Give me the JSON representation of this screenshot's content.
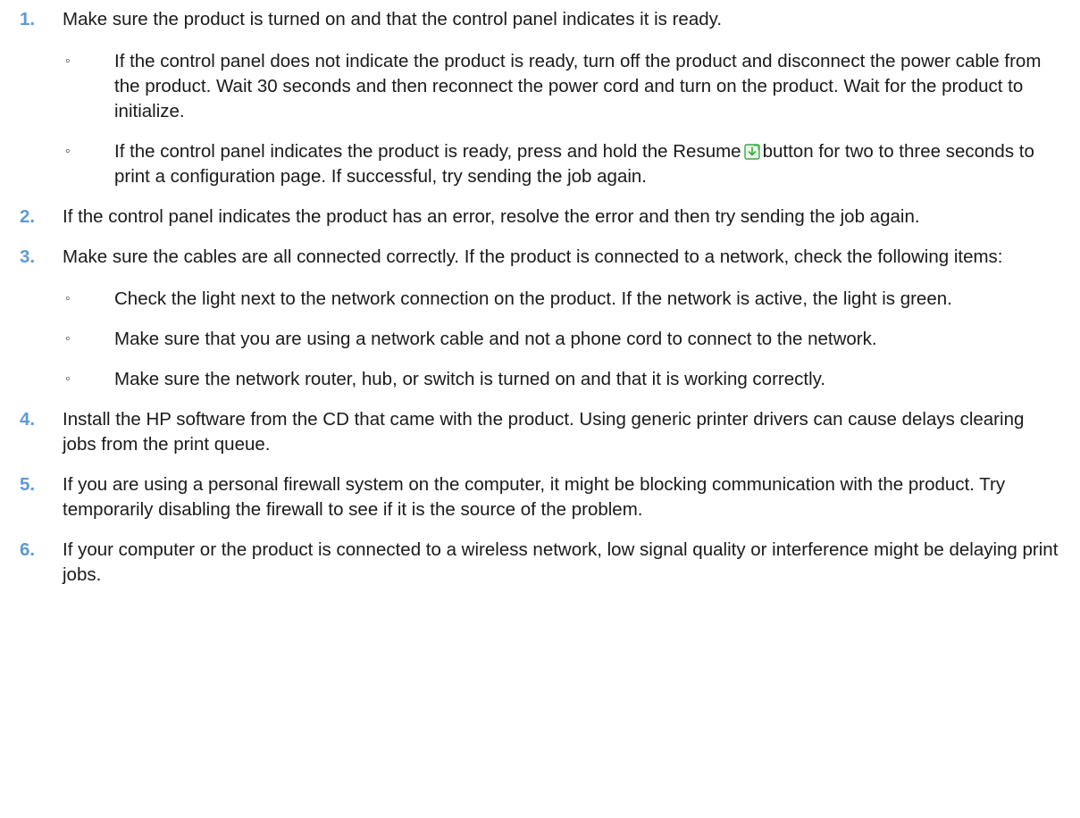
{
  "steps": [
    {
      "number": "1.",
      "text": "Make sure the product is turned on and that the control panel indicates it is ready.",
      "subs": [
        {
          "bullet": "◦",
          "text": "If the control panel does not indicate the product is ready, turn off the product and disconnect the power cable from the product. Wait 30 seconds and then reconnect the power cord and turn on the product. Wait for the product to initialize."
        },
        {
          "bullet": "◦",
          "text_before": "If the control panel indicates the product is ready, press and hold the Resume",
          "icon": "resume-icon",
          "text_after": "button for two to three seconds to print a configuration page. If successful, try sending the job again."
        }
      ]
    },
    {
      "number": "2.",
      "text": "If the control panel indicates the product has an error, resolve the error and then try sending the job again."
    },
    {
      "number": "3.",
      "text": "Make sure the cables are all connected correctly. If the product is connected to a network, check the following items:",
      "subs": [
        {
          "bullet": "◦",
          "text": "Check the light next to the network connection on the product. If the network is active, the light is green."
        },
        {
          "bullet": "◦",
          "text": "Make sure that you are using a network cable and not a phone cord to connect to the network."
        },
        {
          "bullet": "◦",
          "text": "Make sure the network router, hub, or switch is turned on and that it is working correctly."
        }
      ]
    },
    {
      "number": "4.",
      "text": "Install the HP software from the CD that came with the product. Using generic printer drivers can cause delays clearing jobs from the print queue."
    },
    {
      "number": "5.",
      "text": "If you are using a personal firewall system on the computer, it might be blocking communication with the product. Try temporarily disabling the firewall to see if it is the source of the problem."
    },
    {
      "number": "6.",
      "text": "If your computer or the product is connected to a wireless network, low signal quality or interference might be delaying print jobs."
    }
  ],
  "colors": {
    "step_number": "#5b9bd5",
    "resume_icon": "#3aa845"
  }
}
